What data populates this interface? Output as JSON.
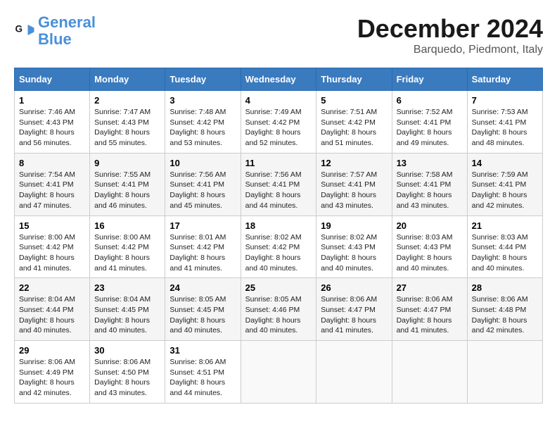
{
  "header": {
    "logo_line1": "General",
    "logo_line2": "Blue",
    "month_title": "December 2024",
    "subtitle": "Barquedo, Piedmont, Italy"
  },
  "calendar": {
    "days_of_week": [
      "Sunday",
      "Monday",
      "Tuesday",
      "Wednesday",
      "Thursday",
      "Friday",
      "Saturday"
    ],
    "weeks": [
      [
        {
          "day": "1",
          "sunrise": "7:46 AM",
          "sunset": "4:43 PM",
          "daylight": "8 hours and 56 minutes."
        },
        {
          "day": "2",
          "sunrise": "7:47 AM",
          "sunset": "4:43 PM",
          "daylight": "8 hours and 55 minutes."
        },
        {
          "day": "3",
          "sunrise": "7:48 AM",
          "sunset": "4:42 PM",
          "daylight": "8 hours and 53 minutes."
        },
        {
          "day": "4",
          "sunrise": "7:49 AM",
          "sunset": "4:42 PM",
          "daylight": "8 hours and 52 minutes."
        },
        {
          "day": "5",
          "sunrise": "7:51 AM",
          "sunset": "4:42 PM",
          "daylight": "8 hours and 51 minutes."
        },
        {
          "day": "6",
          "sunrise": "7:52 AM",
          "sunset": "4:41 PM",
          "daylight": "8 hours and 49 minutes."
        },
        {
          "day": "7",
          "sunrise": "7:53 AM",
          "sunset": "4:41 PM",
          "daylight": "8 hours and 48 minutes."
        }
      ],
      [
        {
          "day": "8",
          "sunrise": "7:54 AM",
          "sunset": "4:41 PM",
          "daylight": "8 hours and 47 minutes."
        },
        {
          "day": "9",
          "sunrise": "7:55 AM",
          "sunset": "4:41 PM",
          "daylight": "8 hours and 46 minutes."
        },
        {
          "day": "10",
          "sunrise": "7:56 AM",
          "sunset": "4:41 PM",
          "daylight": "8 hours and 45 minutes."
        },
        {
          "day": "11",
          "sunrise": "7:56 AM",
          "sunset": "4:41 PM",
          "daylight": "8 hours and 44 minutes."
        },
        {
          "day": "12",
          "sunrise": "7:57 AM",
          "sunset": "4:41 PM",
          "daylight": "8 hours and 43 minutes."
        },
        {
          "day": "13",
          "sunrise": "7:58 AM",
          "sunset": "4:41 PM",
          "daylight": "8 hours and 43 minutes."
        },
        {
          "day": "14",
          "sunrise": "7:59 AM",
          "sunset": "4:41 PM",
          "daylight": "8 hours and 42 minutes."
        }
      ],
      [
        {
          "day": "15",
          "sunrise": "8:00 AM",
          "sunset": "4:42 PM",
          "daylight": "8 hours and 41 minutes."
        },
        {
          "day": "16",
          "sunrise": "8:00 AM",
          "sunset": "4:42 PM",
          "daylight": "8 hours and 41 minutes."
        },
        {
          "day": "17",
          "sunrise": "8:01 AM",
          "sunset": "4:42 PM",
          "daylight": "8 hours and 41 minutes."
        },
        {
          "day": "18",
          "sunrise": "8:02 AM",
          "sunset": "4:42 PM",
          "daylight": "8 hours and 40 minutes."
        },
        {
          "day": "19",
          "sunrise": "8:02 AM",
          "sunset": "4:43 PM",
          "daylight": "8 hours and 40 minutes."
        },
        {
          "day": "20",
          "sunrise": "8:03 AM",
          "sunset": "4:43 PM",
          "daylight": "8 hours and 40 minutes."
        },
        {
          "day": "21",
          "sunrise": "8:03 AM",
          "sunset": "4:44 PM",
          "daylight": "8 hours and 40 minutes."
        }
      ],
      [
        {
          "day": "22",
          "sunrise": "8:04 AM",
          "sunset": "4:44 PM",
          "daylight": "8 hours and 40 minutes."
        },
        {
          "day": "23",
          "sunrise": "8:04 AM",
          "sunset": "4:45 PM",
          "daylight": "8 hours and 40 minutes."
        },
        {
          "day": "24",
          "sunrise": "8:05 AM",
          "sunset": "4:45 PM",
          "daylight": "8 hours and 40 minutes."
        },
        {
          "day": "25",
          "sunrise": "8:05 AM",
          "sunset": "4:46 PM",
          "daylight": "8 hours and 40 minutes."
        },
        {
          "day": "26",
          "sunrise": "8:06 AM",
          "sunset": "4:47 PM",
          "daylight": "8 hours and 41 minutes."
        },
        {
          "day": "27",
          "sunrise": "8:06 AM",
          "sunset": "4:47 PM",
          "daylight": "8 hours and 41 minutes."
        },
        {
          "day": "28",
          "sunrise": "8:06 AM",
          "sunset": "4:48 PM",
          "daylight": "8 hours and 42 minutes."
        }
      ],
      [
        {
          "day": "29",
          "sunrise": "8:06 AM",
          "sunset": "4:49 PM",
          "daylight": "8 hours and 42 minutes."
        },
        {
          "day": "30",
          "sunrise": "8:06 AM",
          "sunset": "4:50 PM",
          "daylight": "8 hours and 43 minutes."
        },
        {
          "day": "31",
          "sunrise": "8:06 AM",
          "sunset": "4:51 PM",
          "daylight": "8 hours and 44 minutes."
        },
        null,
        null,
        null,
        null
      ]
    ]
  }
}
